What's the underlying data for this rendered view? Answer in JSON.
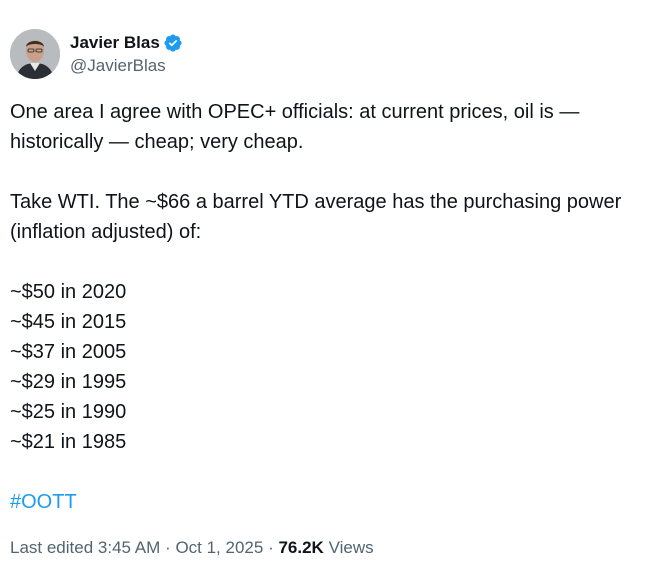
{
  "author": {
    "display_name": "Javier Blas",
    "handle": "@JavierBlas",
    "verified": true,
    "avatar": "profile-photo",
    "verified_icon": "verified-badge-icon",
    "verified_color": "#1d9bf0"
  },
  "tweet": {
    "paragraph_1": "One area I agree with OPEC+ officials: at current prices, oil is —\nhistorically —  cheap; very cheap.",
    "paragraph_2": "Take WTI. The ~$66 a barrel YTD average has the purchasing power\n(inflation adjusted) of:",
    "list": [
      "~$50 in 2020",
      "~$45 in 2015",
      "~$37 in 2005",
      "~$29 in 1995",
      "~$25 in 1990",
      "~$21 in 1985"
    ],
    "hashtag": "#OOTT",
    "hashtag_color": "#1d9bf0"
  },
  "meta": {
    "edited_label": "Last edited",
    "time": "3:45 AM",
    "separator": "·",
    "date": "Oct 1, 2025",
    "views_count": "76.2K",
    "views_label": "Views"
  }
}
